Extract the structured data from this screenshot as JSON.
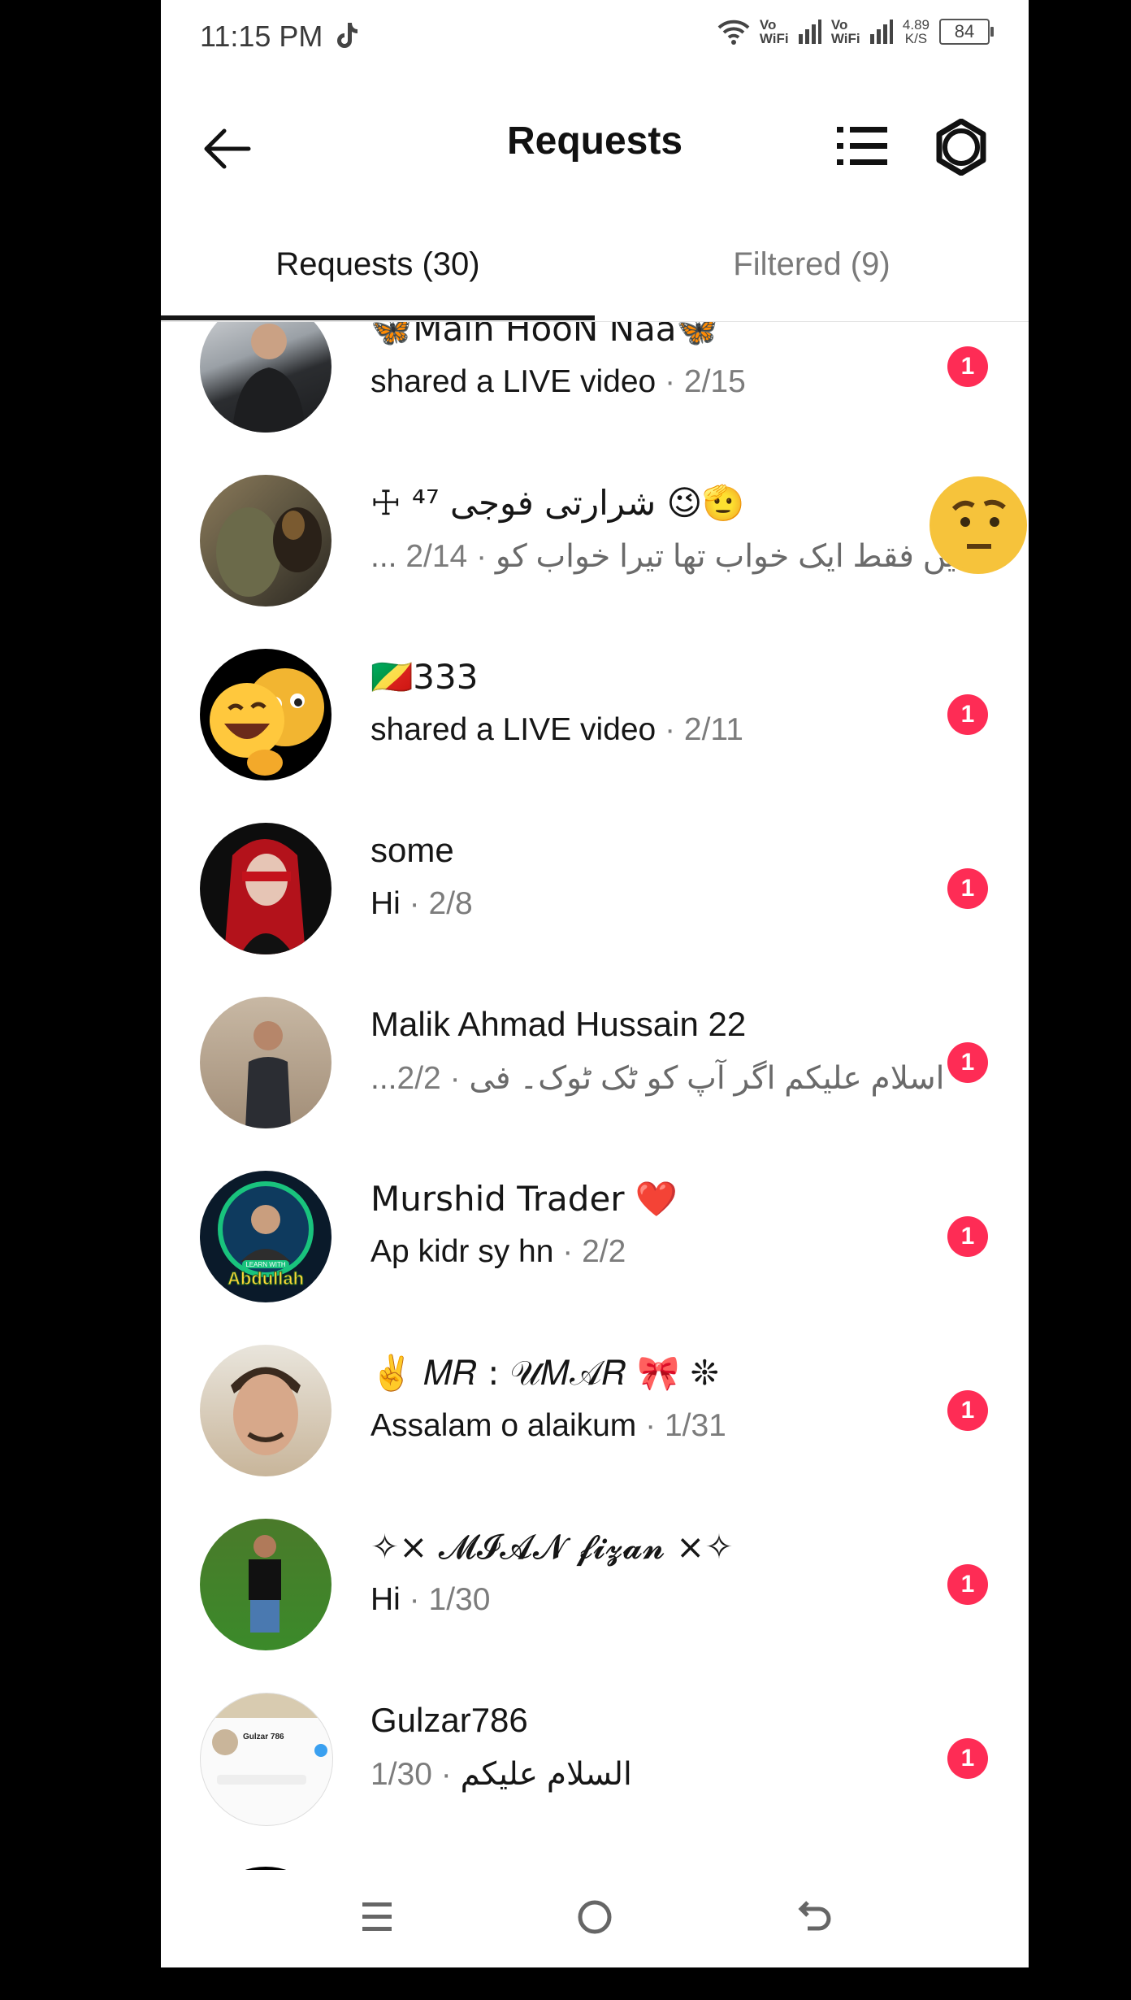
{
  "status_bar": {
    "time": "11:15 PM",
    "vo_wifi_1": "Vo WiFi",
    "vo_wifi_2": "Vo WiFi",
    "net_speed_value": "4.89",
    "net_speed_unit": "K/S",
    "battery": "84"
  },
  "header": {
    "title": "Requests"
  },
  "tabs": [
    {
      "label": "Requests (30)",
      "active": true
    },
    {
      "label": "Filtered (9)",
      "active": false
    }
  ],
  "requests": [
    {
      "name": "🦋Main HooN Naa🦋",
      "message": "shared a LIVE video",
      "date": " · 2/15",
      "unread": "1",
      "avatar": "dark-suit-man"
    },
    {
      "name": "☩ ⁴⁷ شرارتی فوجی 😉🫡",
      "message": "... میں فقط ایک خواب تھا تیرا خواب کو",
      "date": " · 2/14",
      "unread": "",
      "avatar": "soldier-dog"
    },
    {
      "name": "🇨🇬333",
      "message": "shared a LIVE video",
      "date": " · 2/11",
      "unread": "1",
      "avatar": "emoji-faces"
    },
    {
      "name": "some",
      "message": "Hi",
      "date": " · 2/8",
      "unread": "1",
      "avatar": "red-hair-girl"
    },
    {
      "name": "Malik Ahmad Hussain 22",
      "message": "...اسلام علیکم اگر آپ کو ٹک ٹوک۔ فی",
      "date": " · 2/2",
      "unread": "1",
      "avatar": "man-wall"
    },
    {
      "name": "Murshid Trader ❤️",
      "message": "Ap kidr sy hn",
      "date": " · 2/2",
      "unread": "1",
      "avatar": "abdullah-logo"
    },
    {
      "name": "✌️ 𝑀𝑅 : 𝒰𝑀𝒜𝑅 🎀 ❊",
      "message": "Assalam o alaikum",
      "date": " · 1/31",
      "unread": "1",
      "avatar": "man-face"
    },
    {
      "name": "✧× 𝓜𝓘𝓐𝓝 𝓯𝓲𝔃𝓪𝓷 ×✧",
      "message": "Hi",
      "date": " · 1/30",
      "unread": "1",
      "avatar": "field-boy"
    },
    {
      "name": "Gulzar786",
      "message": "السلام علیکم",
      "date": " · 1/30",
      "unread": "1",
      "avatar": "profile-screenshot"
    }
  ],
  "avatar_text": {
    "gulzar_name": "Gulzar 786",
    "abdullah": "Abdullah",
    "learn_with": "LEARN WITH"
  },
  "colors": {
    "badge": "#fe2c55",
    "text": "#161616",
    "secondary": "#7c7c7c"
  }
}
